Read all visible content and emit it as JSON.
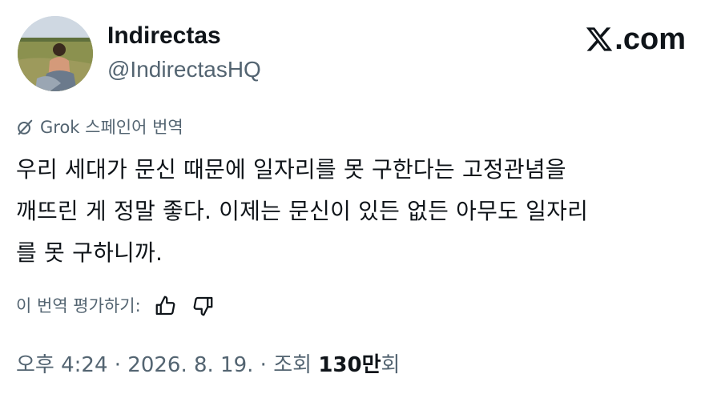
{
  "profile": {
    "display_name": "Indirectas",
    "handle": "@IndirectasHQ",
    "avatar_icon": "avatar-photo"
  },
  "brand": {
    "logo_icon": "x-logo-icon",
    "domain": ".com"
  },
  "translation": {
    "icon": "grok-icon",
    "label": "Grok 스페인어 번역"
  },
  "tweet": {
    "text": "우리 세대가 문신 때문에 일자리를 못 구한다는 고정관념을\n깨뜨린 게 정말 좋다. 이제는 문신이 있든 없든 아무도 일자리\n를 못 구하니까."
  },
  "rating": {
    "label": "이 번역 평가하기:",
    "like_icon": "thumbs-up-icon",
    "dislike_icon": "thumbs-down-icon"
  },
  "meta": {
    "timestamp": "오후 4:24 · 2026. 8. 19. · 조회 ",
    "views_count": "130만",
    "views_suffix": "회"
  },
  "colors": {
    "text_primary": "#0f1419",
    "text_secondary": "#536471",
    "background": "#ffffff"
  }
}
